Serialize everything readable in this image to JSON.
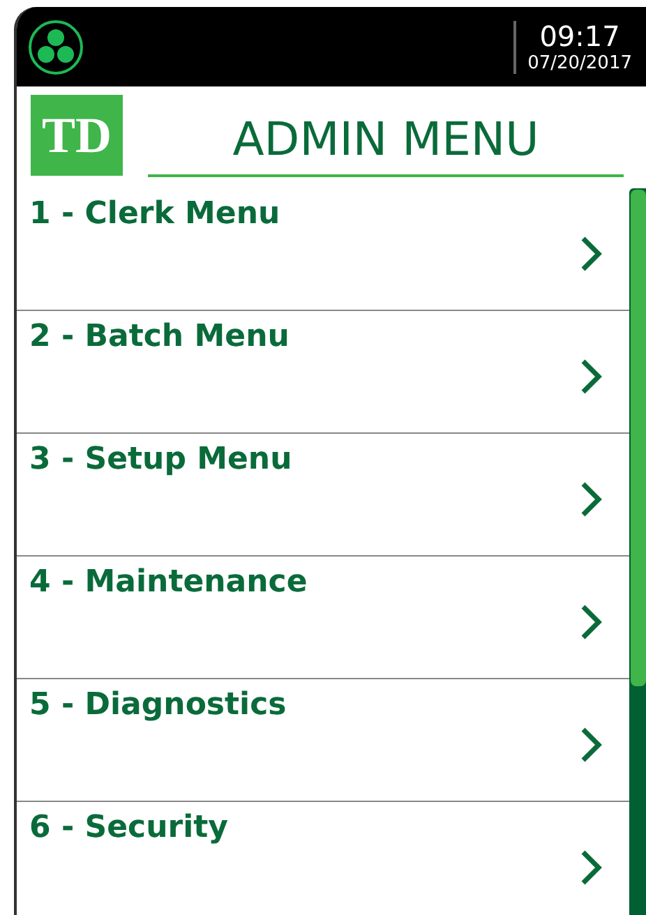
{
  "status_bar": {
    "time": "09:17",
    "date": "07/20/2017"
  },
  "header": {
    "logo_text": "TD",
    "title": "ADMIN MENU"
  },
  "menu_items": [
    {
      "label": "1 - Clerk Menu"
    },
    {
      "label": "2 - Batch Menu"
    },
    {
      "label": "3 - Setup Menu"
    },
    {
      "label": "4 - Maintenance"
    },
    {
      "label": "5 - Diagnostics"
    },
    {
      "label": "6 - Security"
    }
  ]
}
